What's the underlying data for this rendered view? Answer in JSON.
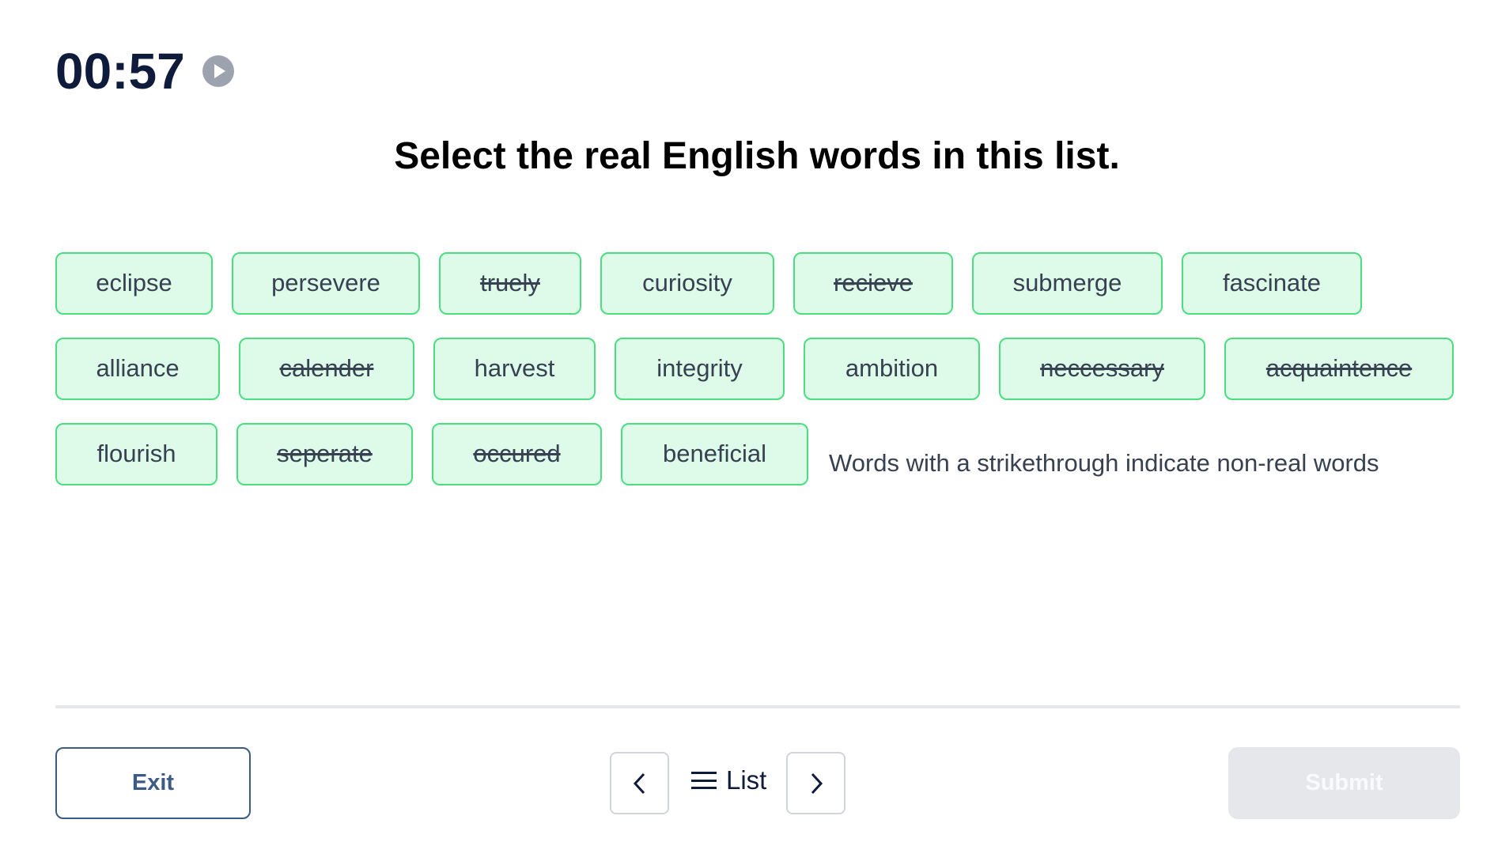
{
  "timer": {
    "value": "00:57",
    "play_icon": "play-circle-icon"
  },
  "question": {
    "title": "Select the real English words in this list."
  },
  "words": {
    "rows": [
      [
        {
          "label": "eclipse",
          "strikethrough": false
        },
        {
          "label": "persevere",
          "strikethrough": false
        },
        {
          "label": "truely",
          "strikethrough": true
        },
        {
          "label": "curiosity",
          "strikethrough": false
        },
        {
          "label": "recieve",
          "strikethrough": true
        },
        {
          "label": "submerge",
          "strikethrough": false
        },
        {
          "label": "fascinate",
          "strikethrough": false
        }
      ],
      [
        {
          "label": "alliance",
          "strikethrough": false
        },
        {
          "label": "calender",
          "strikethrough": true
        },
        {
          "label": "harvest",
          "strikethrough": false
        },
        {
          "label": "integrity",
          "strikethrough": false
        },
        {
          "label": "ambition",
          "strikethrough": false
        },
        {
          "label": "neccessary",
          "strikethrough": true
        },
        {
          "label": "acquaintence",
          "strikethrough": true
        }
      ],
      [
        {
          "label": "flourish",
          "strikethrough": false
        },
        {
          "label": "seperate",
          "strikethrough": true
        },
        {
          "label": "occured",
          "strikethrough": true
        },
        {
          "label": "beneficial",
          "strikethrough": false
        }
      ]
    ],
    "hint": "Words with a strikethrough indicate non-real words"
  },
  "footer": {
    "exit_label": "Exit",
    "prev_icon": "chevron-left-icon",
    "list_icon": "hamburger-menu-icon",
    "list_label": "List",
    "next_icon": "chevron-right-icon",
    "submit_label": "Submit",
    "submit_disabled": true
  },
  "colors": {
    "chip_bg": "#ddfbe8",
    "chip_border": "#4ade80",
    "timer_text": "#0f1b3a",
    "exit_accent": "#3b5a85",
    "submit_disabled_bg": "#e5e7eb"
  }
}
